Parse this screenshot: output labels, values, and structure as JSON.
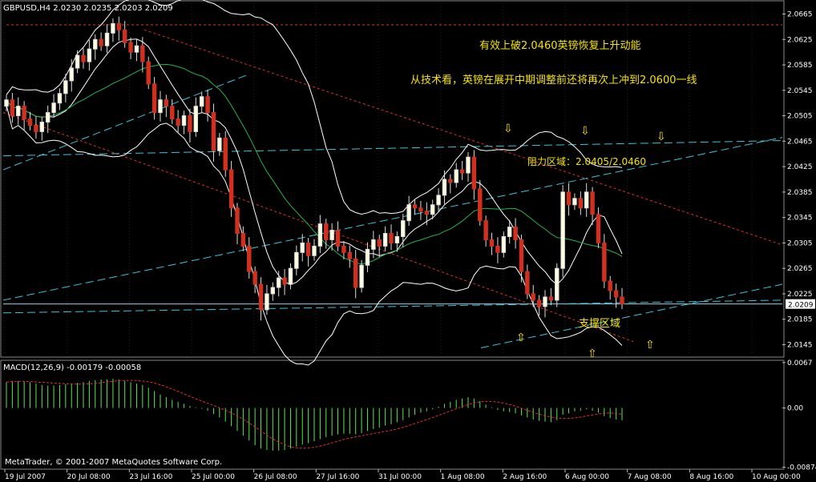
{
  "chart_data": {
    "type": "candlestick",
    "symbol_header": "GBPUSD,H4  2.0230 2.0235 2.0203 2.0209",
    "price_axis_ticks": [
      "2.0665",
      "2.0625",
      "2.0585",
      "2.0545",
      "2.0505",
      "2.0465",
      "2.0425",
      "2.0385",
      "2.0345",
      "2.0305",
      "2.0265",
      "2.0225",
      "2.0185",
      "2.0145"
    ],
    "price_range": [
      2.0128,
      2.0682
    ],
    "current_price": "2.0209",
    "time_axis_labels": [
      "19 Jul 2007",
      "20 Jul 08:00",
      "23 Jul 16:00",
      "25 Jul 00:00",
      "26 Jul 08:00",
      "27 Jul 16:00",
      "31 Jul 00:00",
      "1 Aug 08:00",
      "2 Aug 16:00",
      "6 Aug 00:00",
      "7 Aug 08:00",
      "8 Aug 16:00",
      "10 Aug 00:00"
    ],
    "closes": [
      2.053,
      2.0505,
      2.052,
      2.05,
      2.049,
      2.048,
      2.0495,
      2.051,
      2.0525,
      2.054,
      2.056,
      2.058,
      2.06,
      2.059,
      2.061,
      2.0625,
      2.0615,
      2.0635,
      2.065,
      2.064,
      2.062,
      2.0605,
      2.0615,
      2.059,
      2.0555,
      2.051,
      2.053,
      2.052,
      2.05,
      2.049,
      2.0505,
      2.048,
      2.052,
      2.0535,
      2.051,
      2.045,
      2.047,
      2.042,
      2.036,
      2.032,
      2.03,
      2.026,
      2.024,
      2.02,
      2.0225,
      2.0235,
      2.025,
      2.024,
      2.0265,
      2.029,
      2.0305,
      2.0285,
      2.03,
      2.0335,
      2.031,
      2.0325,
      2.03,
      2.029,
      2.028,
      2.0235,
      2.027,
      2.0295,
      2.031,
      2.03,
      2.032,
      2.0305,
      2.0315,
      2.034,
      2.0365,
      2.036,
      2.0355,
      2.035,
      2.0365,
      2.038,
      2.0405,
      2.04,
      2.042,
      2.0415,
      2.044,
      2.039,
      2.034,
      2.031,
      2.03,
      2.029,
      2.0315,
      2.033,
      2.031,
      2.026,
      2.0225,
      2.0215,
      2.0205,
      2.022,
      2.0215,
      2.0265,
      2.0385,
      2.0365,
      2.0375,
      2.036,
      2.0385,
      2.035,
      2.0305,
      2.0245,
      2.023,
      2.022,
      2.0209
    ],
    "bollinger_bands": "white",
    "moving_average": "green",
    "macd": {
      "label": "MACD(12,26,9) -0.00179 -0.00058",
      "axis_ticks": [
        "0.0067",
        "0.00",
        "-0.00874"
      ],
      "range": [
        -0.0088,
        0.0068
      ],
      "histogram": [
        0.0038,
        0.004,
        0.004,
        0.0039,
        0.0038,
        0.0036,
        0.0034,
        0.0033,
        0.0033,
        0.0034,
        0.0035,
        0.0036,
        0.0037,
        0.0038,
        0.004,
        0.0041,
        0.0042,
        0.0042,
        0.0043,
        0.0042,
        0.004,
        0.0038,
        0.0036,
        0.0034,
        0.003,
        0.0025,
        0.002,
        0.0016,
        0.0012,
        0.0009,
        0.0006,
        0.0003,
        0.0001,
        -0.0001,
        -0.0004,
        -0.0009,
        -0.0014,
        -0.002,
        -0.0027,
        -0.0034,
        -0.0041,
        -0.0048,
        -0.0055,
        -0.006,
        -0.0062,
        -0.0063,
        -0.0063,
        -0.0062,
        -0.006,
        -0.0057,
        -0.0054,
        -0.0052,
        -0.0049,
        -0.0046,
        -0.0043,
        -0.0041,
        -0.0039,
        -0.0038,
        -0.0038,
        -0.0039,
        -0.0037,
        -0.0034,
        -0.0031,
        -0.0029,
        -0.0026,
        -0.0024,
        -0.0021,
        -0.0018,
        -0.0014,
        -0.001,
        -0.0007,
        -0.0005,
        -0.0002,
        0.0002,
        0.0006,
        0.0009,
        0.0012,
        0.0014,
        0.0016,
        0.0014,
        0.001,
        0.0005,
        0.0001,
        -0.0003,
        -0.0005,
        -0.0006,
        -0.0008,
        -0.0011,
        -0.0014,
        -0.0017,
        -0.0019,
        -0.002,
        -0.0021,
        -0.0018,
        -0.001,
        -0.0008,
        -0.0005,
        -0.0004,
        -0.0002,
        -0.0004,
        -0.0007,
        -0.0012,
        -0.0015,
        -0.0017,
        -0.0018
      ],
      "signal_color": "red",
      "histogram_color": "green"
    }
  },
  "annotations": {
    "headline": "有效上破2.0460英镑恢复上升动能",
    "subline": "从技术看，英镑在展开中期调整前还将再次上冲到2.0600一线",
    "resistance": "阻力区域：2.0405/2.0460",
    "support": "支撑区域"
  },
  "arrow_glyphs": {
    "down": "⇩",
    "up": "⇧"
  },
  "copyright": "MetaTrader, © 2001-2007 MetaQuotes Software Corp.",
  "colors": {
    "background": "#000000",
    "grid": "#808080",
    "bull_candle": "#ffffe0",
    "bear_candle": "#d2301f",
    "trendline_cyan": "#3fc4d8",
    "trendline_red": "#e0302a",
    "bollinger": "#ffffff",
    "ma_green": "#27b24a",
    "annotation_yellow": "#f5e400",
    "macd_hist": "#5be84f",
    "macd_signal": "#e03030"
  }
}
